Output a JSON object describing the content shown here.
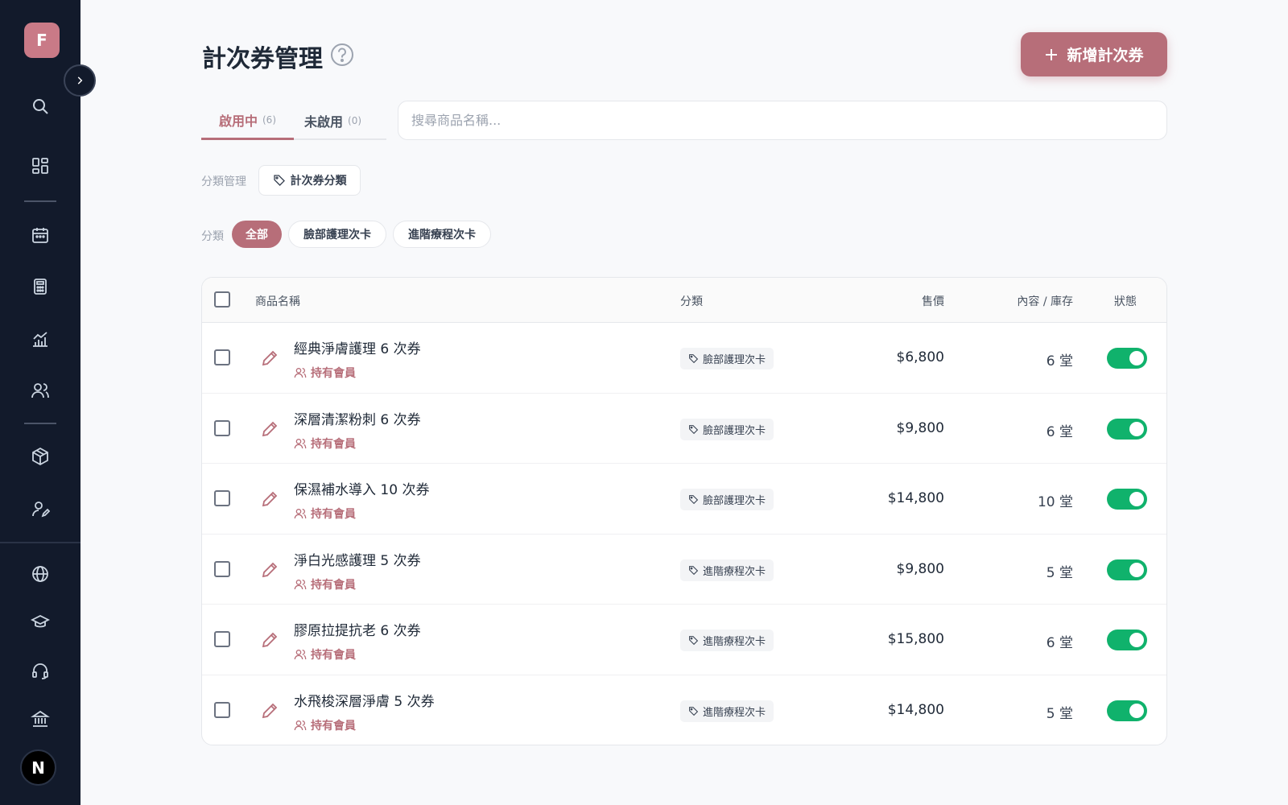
{
  "sidebar": {
    "logo_letter": "F",
    "avatar_letter": "N",
    "icons": [
      "search-icon",
      "dashboard-icon",
      "calendar-icon",
      "calculator-icon",
      "analytics-icon",
      "users-icon",
      "package-icon",
      "user-settings-icon",
      "globe-icon",
      "graduation-cap-icon",
      "headset-icon",
      "bank-icon"
    ],
    "colors": {
      "background": "#121a2b",
      "logo": "#c97a87"
    }
  },
  "header": {
    "title": "計次券管理",
    "add_button_label": "新增計次券"
  },
  "tabs": [
    {
      "label": "啟用中",
      "count": "(6)"
    },
    {
      "label": "未啟用",
      "count": "(0)"
    }
  ],
  "search": {
    "placeholder": "搜尋商品名稱..."
  },
  "category_management": {
    "label": "分類管理",
    "button_label": "計次券分類"
  },
  "filter": {
    "label": "分類",
    "chips": [
      "全部",
      "臉部護理次卡",
      "進階療程次卡"
    ]
  },
  "table": {
    "headers": {
      "name": "商品名稱",
      "category": "分類",
      "price": "售價",
      "content": "內容 / 庫存",
      "status": "狀態"
    },
    "holders_label": "持有會員",
    "rows": [
      {
        "name": "經典淨膚護理 6 次券",
        "category": "臉部護理次卡",
        "price": "$6,800",
        "content": "6 堂",
        "active": true
      },
      {
        "name": "深層清潔粉刺 6 次券",
        "category": "臉部護理次卡",
        "price": "$9,800",
        "content": "6 堂",
        "active": true
      },
      {
        "name": "保濕補水導入 10 次券",
        "category": "臉部護理次卡",
        "price": "$14,800",
        "content": "10 堂",
        "active": true
      },
      {
        "name": "淨白光感護理 5 次券",
        "category": "進階療程次卡",
        "price": "$9,800",
        "content": "5 堂",
        "active": true
      },
      {
        "name": "膠原拉提抗老 6 次券",
        "category": "進階療程次卡",
        "price": "$15,800",
        "content": "6 堂",
        "active": true
      },
      {
        "name": "水飛梭深層淨膚 5 次券",
        "category": "進階療程次卡",
        "price": "$14,800",
        "content": "5 堂",
        "active": true
      }
    ]
  },
  "colors": {
    "accent": "#b76e79",
    "toggle_on": "#10b26c"
  }
}
